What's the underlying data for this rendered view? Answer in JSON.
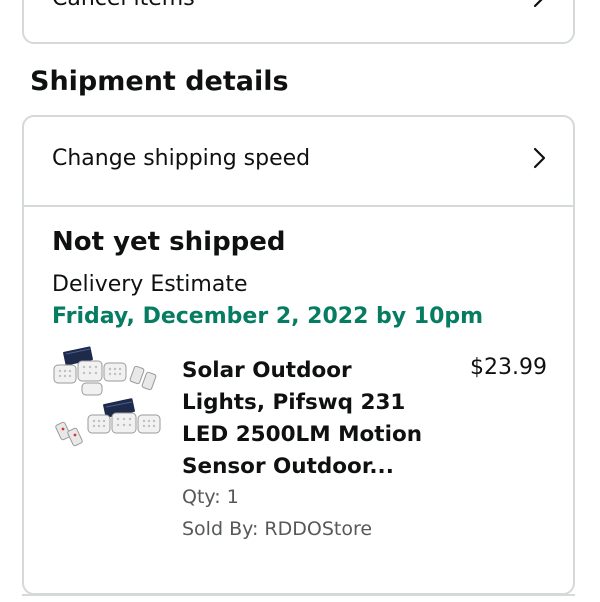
{
  "cancel_items": {
    "label": "Cancel items",
    "icon": "chevron-right-icon"
  },
  "shipment": {
    "title": "Shipment details",
    "change_speed": {
      "label": "Change shipping speed",
      "icon": "chevron-right-icon"
    },
    "status": "Not yet shipped",
    "estimate_label": "Delivery Estimate",
    "estimate_date": "Friday, December 2, 2022 by 10pm",
    "estimate_color": "#067d62",
    "product": {
      "title": "Solar Outdoor Lights, Pifswq 231 LED 2500LM Motion Sensor Outdoor...",
      "price": "$23.99",
      "qty": "Qty: 1",
      "sold_by": "Sold By: RDDOStore",
      "image_icon": "solar-light-product-image"
    }
  },
  "colors": {
    "border": "#d5d9d9",
    "text": "#0f1111",
    "secondary_text": "#565959"
  }
}
